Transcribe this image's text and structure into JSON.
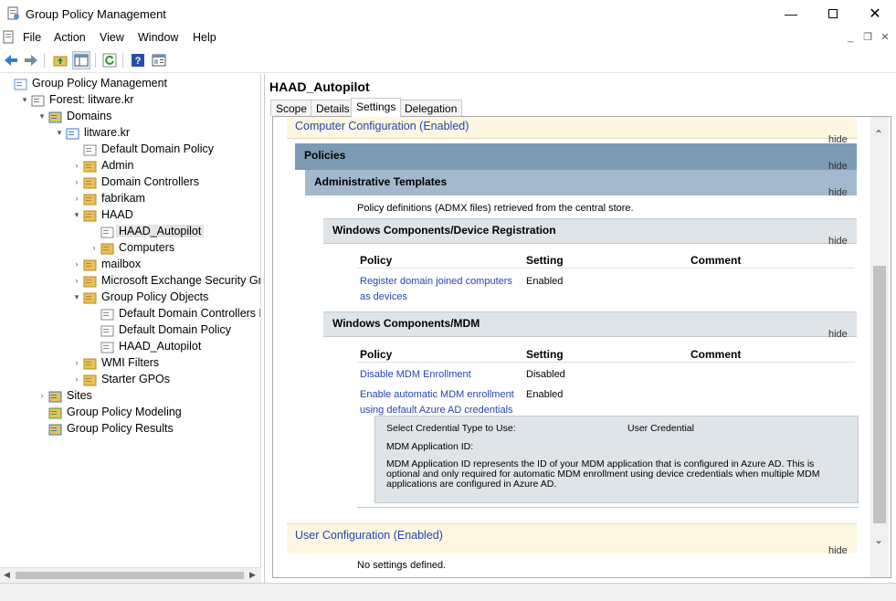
{
  "window": {
    "title": "Group Policy Management",
    "minimize_icon": "minimize-icon",
    "maximize_icon": "maximize-icon",
    "close_icon": "close-icon"
  },
  "menu": {
    "items": [
      "File",
      "Action",
      "View",
      "Window",
      "Help"
    ]
  },
  "toolbar": {
    "icons": [
      "back-arrow-icon",
      "forward-arrow-icon",
      "up-folder-icon",
      "show-hide-tree-icon",
      "refresh-icon",
      "help-icon",
      "properties-icon"
    ]
  },
  "tree": {
    "items": [
      {
        "label": "Group Policy Management",
        "icon": "gpm-icon",
        "expander": ""
      },
      {
        "label": "Forest: litware.kr",
        "icon": "forest-icon",
        "expander": "▾"
      },
      {
        "label": "Domains",
        "icon": "domains-icon",
        "expander": "▾"
      },
      {
        "label": "litware.kr",
        "icon": "domain-icon",
        "expander": "▾"
      },
      {
        "label": "Default Domain Policy",
        "icon": "gpo-link-icon",
        "expander": ""
      },
      {
        "label": "Admin",
        "icon": "ou-folder-icon",
        "expander": "›"
      },
      {
        "label": "Domain Controllers",
        "icon": "ou-folder-icon",
        "expander": "›"
      },
      {
        "label": "fabrikam",
        "icon": "ou-folder-icon",
        "expander": "›"
      },
      {
        "label": "HAAD",
        "icon": "ou-folder-icon",
        "expander": "▾"
      },
      {
        "label": "HAAD_Autopilot",
        "icon": "gpo-link-icon",
        "expander": ""
      },
      {
        "label": "Computers",
        "icon": "ou-folder-icon",
        "expander": "›"
      },
      {
        "label": "mailbox",
        "icon": "ou-folder-icon",
        "expander": "›"
      },
      {
        "label": "Microsoft Exchange Security Group",
        "icon": "ou-folder-icon",
        "expander": "›"
      },
      {
        "label": "Group Policy Objects",
        "icon": "folder-icon",
        "expander": "▾"
      },
      {
        "label": "Default Domain Controllers Pol",
        "icon": "gpo-icon",
        "expander": ""
      },
      {
        "label": "Default Domain Policy",
        "icon": "gpo-icon",
        "expander": ""
      },
      {
        "label": "HAAD_Autopilot",
        "icon": "gpo-icon",
        "expander": ""
      },
      {
        "label": "WMI Filters",
        "icon": "folder-icon",
        "expander": "›"
      },
      {
        "label": "Starter GPOs",
        "icon": "folder-icon",
        "expander": "›"
      },
      {
        "label": "Sites",
        "icon": "sites-icon",
        "expander": "›"
      },
      {
        "label": "Group Policy Modeling",
        "icon": "modeling-icon",
        "expander": ""
      },
      {
        "label": "Group Policy Results",
        "icon": "results-icon",
        "expander": ""
      }
    ]
  },
  "details": {
    "title": "HAAD_Autopilot",
    "tabs": [
      "Scope",
      "Details",
      "Settings",
      "Delegation"
    ],
    "active_tab": "Settings"
  },
  "report": {
    "computer_config": "Computer Configuration (Enabled)",
    "hide": "hide",
    "policies": "Policies",
    "admin_templates": "Administrative Templates",
    "admx_note": "Policy definitions (ADMX files) retrieved from the central store.",
    "device_registration": {
      "title": "Windows Components/Device Registration",
      "headers": [
        "Policy",
        "Setting",
        "Comment"
      ],
      "rows": [
        {
          "policy_line1": "Register domain joined computers",
          "policy_line2": "as devices",
          "setting": "Enabled"
        }
      ]
    },
    "mdm": {
      "title": "Windows Components/MDM",
      "headers": [
        "Policy",
        "Setting",
        "Comment"
      ],
      "rows": [
        {
          "policy_line1": "Disable MDM Enrollment",
          "policy_line2": "",
          "setting": "Disabled"
        },
        {
          "policy_line1": "Enable automatic MDM enrollment",
          "policy_line2": "using default Azure AD credentials",
          "setting": "Enabled"
        }
      ],
      "detail": {
        "credential_label": "Select Credential Type to Use:",
        "credential_value": "User Credential",
        "app_id_label": "MDM Application ID:",
        "description_line1": "MDM Application ID represents the ID of your MDM application that is configured in Azure AD. This is",
        "description_line2": "optional and only required for automatic MDM enrollment using device credentials when multiple MDM",
        "description_line3": "applications are configured in Azure AD."
      }
    },
    "user_config": "User Configuration (Enabled)",
    "no_settings": "No settings defined."
  }
}
